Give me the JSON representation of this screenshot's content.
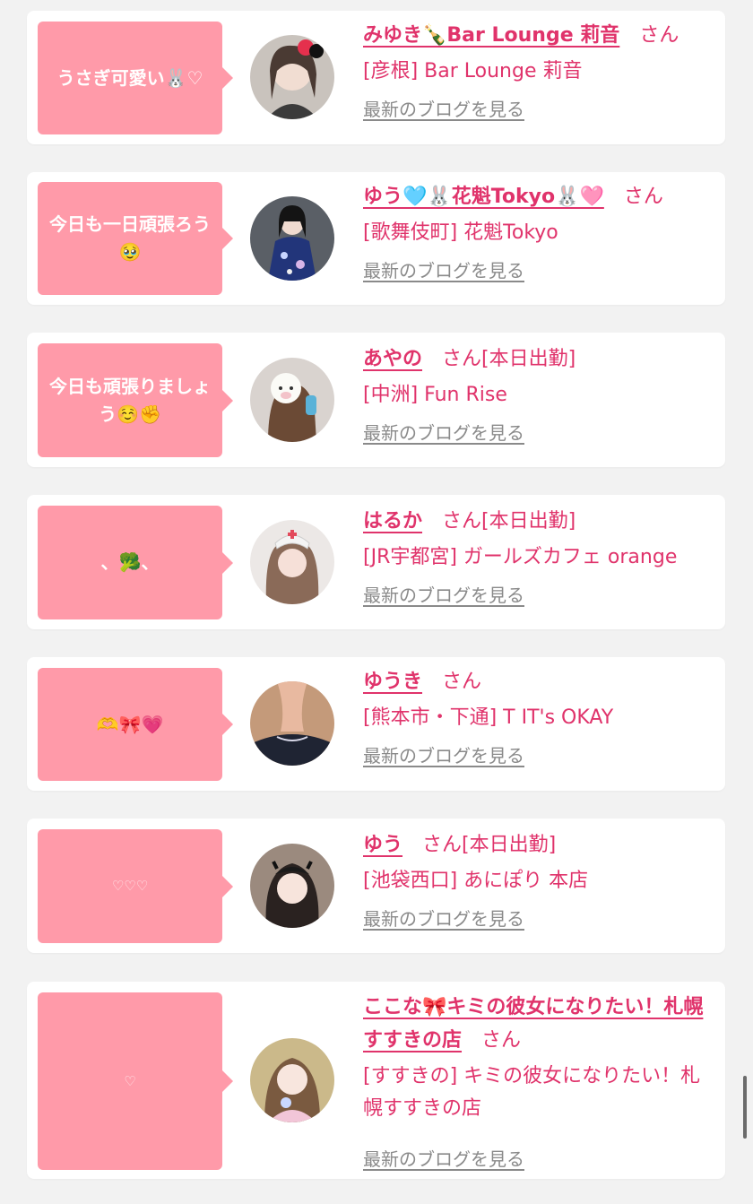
{
  "cards": [
    {
      "message": "うさぎ可愛い🐰♡",
      "name": "みゆき🍾Bar Lounge 莉音",
      "honorific": "さん",
      "status": "",
      "shop": "[彦根] Bar Lounge 莉音",
      "blog_link": "最新のブログを見る"
    },
    {
      "message": "今日も一日頑張ろう🥹",
      "name": "ゆう🩵🐰花魁Tokyo🐰🩷",
      "honorific": "さん",
      "status": "",
      "shop": "[歌舞伎町] 花魁Tokyo",
      "blog_link": "最新のブログを見る"
    },
    {
      "message": "今日も頑張りましょう☺️✊",
      "name": "あやの",
      "honorific": "さん",
      "status": "[本日出勤]",
      "shop": "[中洲] Fun Rise",
      "blog_link": "最新のブログを見る"
    },
    {
      "message": "、🥦、",
      "name": "はるか",
      "honorific": "さん",
      "status": "[本日出勤]",
      "shop": "[JR宇都宮] ガールズカフェ orange",
      "blog_link": "最新のブログを見る"
    },
    {
      "message": "🫶🎀💗",
      "name": "ゆうき",
      "honorific": "さん",
      "status": "",
      "shop": "[熊本市・下通] T IT's OKAY",
      "blog_link": "最新のブログを見る"
    },
    {
      "message": "♡♡♡",
      "name": "ゆう",
      "honorific": "さん",
      "status": "[本日出勤]",
      "shop": "[池袋西口] あにぽり 本店",
      "blog_link": "最新のブログを見る"
    },
    {
      "message": "♡",
      "name": "ここな🎀キミの彼女になりたい！札幌すすきの店",
      "honorific": "さん",
      "status": "",
      "shop": "[すすきの] キミの彼女になりたい！札幌すすきの店",
      "blog_link": "最新のブログを見る"
    }
  ],
  "colors": {
    "bubble": "#ff9aa9",
    "accent": "#e0336b",
    "link_gray": "#8a8a8a",
    "background": "#f2f2f2"
  }
}
